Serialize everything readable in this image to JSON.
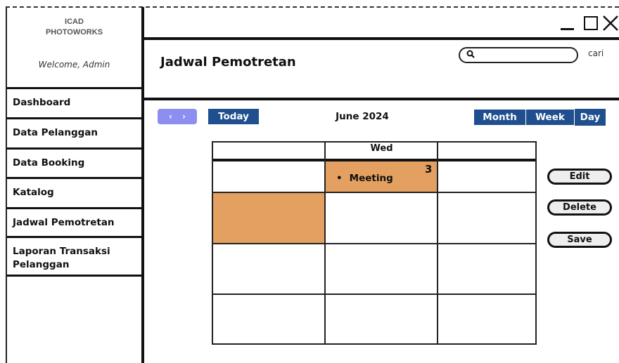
{
  "app": {
    "brand_line1": "ICAD",
    "brand_line2": "PHOTOWORKS",
    "welcome": "Welcome, Admin"
  },
  "sidebar": {
    "items": [
      {
        "label": "Dashboard"
      },
      {
        "label": "Data Pelanggan"
      },
      {
        "label": "Data Booking"
      },
      {
        "label": "Katalog"
      },
      {
        "label": "Jadwal Pemotretan"
      },
      {
        "label": "Laporan Transaksi Pelanggan"
      }
    ]
  },
  "window": {
    "controls": [
      "minimize-icon",
      "maximize-icon",
      "close-icon"
    ]
  },
  "header": {
    "title": "Jadwal Pemotretan",
    "search_label": "cari",
    "search_value": "",
    "search_icon": "search-icon"
  },
  "calendar": {
    "prev_label": "‹",
    "next_label": "›",
    "today_label": "Today",
    "month_label": "June 2024",
    "view_buttons": [
      "Month",
      "Week",
      "Day"
    ],
    "day_header": "Wed",
    "day_number": "3",
    "event": "Meeting",
    "event_color": "#e4a060",
    "accent": "#1f4f8e",
    "nav_color": "#8c8ef0"
  },
  "actions": {
    "edit": "Edit",
    "delete": "Delete",
    "save": "Save"
  }
}
